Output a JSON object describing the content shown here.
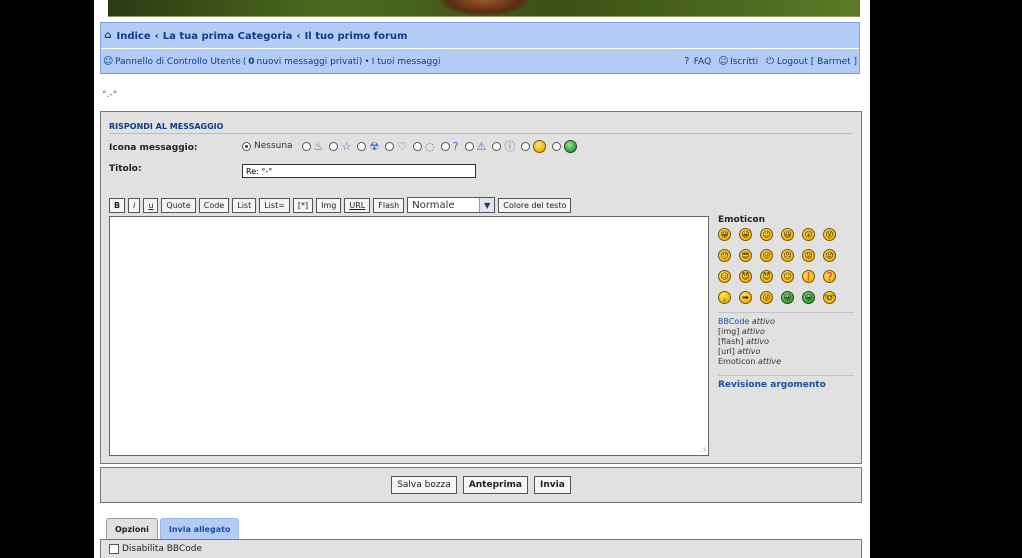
{
  "nav": {
    "breadcrumb": [
      "Indice",
      "La tua prima Categoria",
      "Il tuo primo forum"
    ],
    "crumb_sep": "‹",
    "ucp_link": "Pannello di Controllo Utente",
    "pm_open": " (",
    "pm_count": "0",
    "pm_text": " nuovi messaggi privati)",
    "bullet": " • ",
    "my_posts": "I tuoi messaggi",
    "faq": "FAQ",
    "members": "Iscritti",
    "logout": "Logout [ Barrnet ]"
  },
  "smiley_text": "°.-°",
  "post": {
    "heading": "RISPONDI AL MESSAGGIO",
    "icon_label": "Icona messaggio:",
    "icon_none": "Nessuna",
    "icons": [
      "fire-icon",
      "star-icon",
      "radioactive-icon",
      "heart-icon",
      "speech-bubble-icon",
      "question-icon",
      "warning-icon",
      "info-icon",
      "mrgreen-icon",
      "alien-icon"
    ],
    "title_label": "Titolo:",
    "title_value": "Re: °-°",
    "toolbar": {
      "b": "B",
      "i": "i",
      "u": "u",
      "quote": "Quote",
      "code": "Code",
      "list": "List",
      "list_eq": "List=",
      "star": "[*]",
      "img": "Img",
      "url": "URL",
      "flash": "Flash",
      "font_size": "Normale",
      "color": "Colore del testo"
    }
  },
  "emoticons": {
    "title": "Emoticon",
    "faces": [
      "😁",
      "😀",
      "😉",
      "😆",
      "😲",
      "😵",
      "😯",
      "😎",
      "😛",
      "😠",
      "😡",
      "😟",
      "😑",
      "😈",
      "😈",
      "😐",
      "❗",
      "❓",
      "💡",
      "➡",
      "😜",
      "😀",
      "😀",
      "🤓"
    ]
  },
  "status": {
    "bbcode": "BBCode",
    "bbcode_state": "attivo",
    "img": "[img]",
    "img_state": "attivo",
    "flash": "[flash]",
    "flash_state": "attivo",
    "url": "[url]",
    "url_state": "attivo",
    "smilies": "Emoticon",
    "smilies_state": "attive",
    "review": "Revisione argomento"
  },
  "submit": {
    "draft": "Salva bozza",
    "preview": "Anteprima",
    "send": "Invia"
  },
  "tabs": [
    "Opzioni",
    "Invia allegato"
  ],
  "options": {
    "disable_bbcode": "Disabilita BBCode"
  }
}
